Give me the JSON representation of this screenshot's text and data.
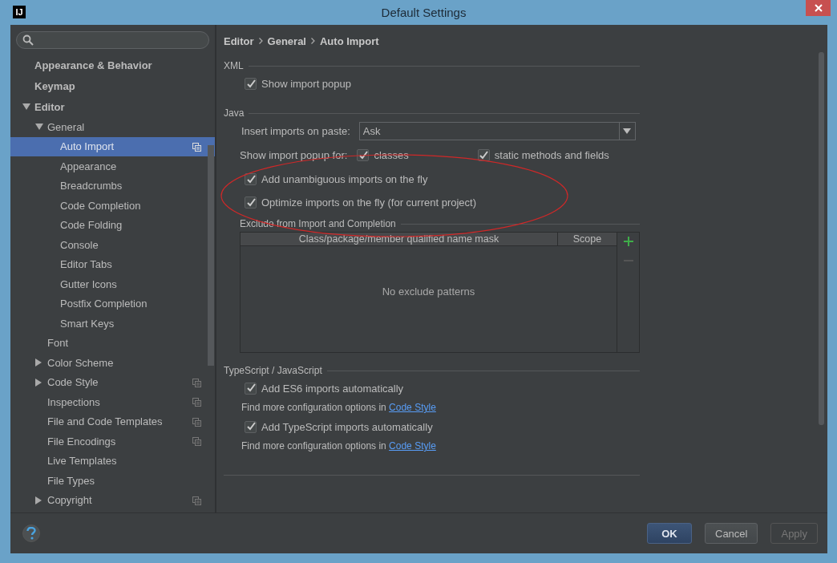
{
  "window": {
    "title": "Default Settings",
    "app_logo": "IJ"
  },
  "sidebar": {
    "items": [
      {
        "label": "Appearance & Behavior",
        "selected": false,
        "shared": false
      },
      {
        "label": "Keymap",
        "selected": false,
        "shared": false
      },
      {
        "label": "Editor",
        "selected": false,
        "shared": false,
        "expanded": true,
        "children": [
          {
            "label": "General",
            "selected": false,
            "shared": false,
            "expanded": true,
            "children": [
              {
                "label": "Auto Import",
                "selected": true,
                "shared": true
              },
              {
                "label": "Appearance",
                "selected": false,
                "shared": false
              },
              {
                "label": "Breadcrumbs",
                "selected": false,
                "shared": false
              },
              {
                "label": "Code Completion",
                "selected": false,
                "shared": false
              },
              {
                "label": "Code Folding",
                "selected": false,
                "shared": false
              },
              {
                "label": "Console",
                "selected": false,
                "shared": false
              },
              {
                "label": "Editor Tabs",
                "selected": false,
                "shared": false
              },
              {
                "label": "Gutter Icons",
                "selected": false,
                "shared": false
              },
              {
                "label": "Postfix Completion",
                "selected": false,
                "shared": false
              },
              {
                "label": "Smart Keys",
                "selected": false,
                "shared": false
              }
            ]
          },
          {
            "label": "Font",
            "selected": false,
            "shared": false
          },
          {
            "label": "Color Scheme",
            "selected": false,
            "shared": false,
            "expanded": false
          },
          {
            "label": "Code Style",
            "selected": false,
            "shared": true,
            "expanded": false
          },
          {
            "label": "Inspections",
            "selected": false,
            "shared": true
          },
          {
            "label": "File and Code Templates",
            "selected": false,
            "shared": true
          },
          {
            "label": "File Encodings",
            "selected": false,
            "shared": true
          },
          {
            "label": "Live Templates",
            "selected": false,
            "shared": false
          },
          {
            "label": "File Types",
            "selected": false,
            "shared": false
          },
          {
            "label": "Copyright",
            "selected": false,
            "shared": true,
            "expanded": false
          }
        ]
      }
    ]
  },
  "breadcrumb": [
    "Editor",
    "General",
    "Auto Import"
  ],
  "sections": [
    {
      "title": "XML",
      "rows": [
        {
          "kind": "checkbox",
          "label": "Show import popup",
          "checked": true
        }
      ]
    },
    {
      "title": "Java",
      "rows": [
        {
          "kind": "combo",
          "label": "Insert imports on paste:",
          "value": "Ask"
        },
        {
          "kind": "options",
          "label": "Show import popup for:",
          "options": [
            {
              "label": "classes",
              "checked": true
            },
            {
              "label": "static methods and fields",
              "checked": true
            }
          ]
        },
        {
          "kind": "checkbox",
          "label": "Add unambiguous imports on the fly",
          "checked": true
        },
        {
          "kind": "checkbox",
          "label": "Optimize imports on the fly (for current project)",
          "checked": true
        },
        {
          "kind": "table",
          "title": "Exclude from Import and Completion",
          "columns": [
            "Class/package/member qualified name mask",
            "Scope"
          ],
          "empty_text": "No exclude patterns"
        }
      ]
    },
    {
      "title": "TypeScript / JavaScript",
      "rows": [
        {
          "kind": "checkbox",
          "label": "Add ES6 imports automatically",
          "checked": true
        },
        {
          "kind": "note",
          "text": "Find more configuration options in",
          "link": "Code Style"
        },
        {
          "kind": "checkbox",
          "label": "Add TypeScript imports automatically",
          "checked": true
        },
        {
          "kind": "note",
          "text": "Find more configuration options in",
          "link": "Code Style"
        }
      ]
    }
  ],
  "buttons": [
    {
      "label": "OK",
      "default": true,
      "disabled": false
    },
    {
      "label": "Cancel",
      "default": false,
      "disabled": false
    },
    {
      "label": "Apply",
      "default": false,
      "disabled": true
    }
  ]
}
